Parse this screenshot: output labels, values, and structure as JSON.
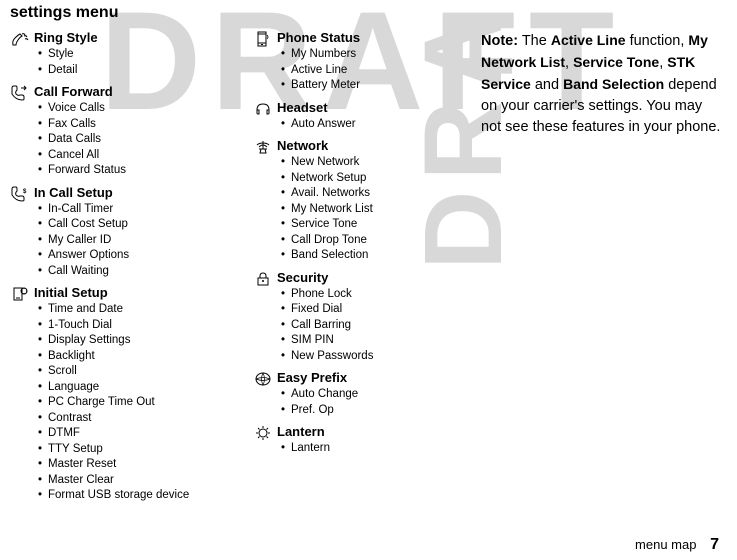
{
  "watermark": "DRAFT",
  "title": "settings menu",
  "col1": {
    "sections": [
      {
        "icon": "ring-style-icon",
        "title": "Ring Style",
        "items": [
          "Style",
          "Detail"
        ]
      },
      {
        "icon": "call-forward-icon",
        "title": "Call Forward",
        "items": [
          "Voice Calls",
          "Fax Calls",
          "Data Calls",
          "Cancel All",
          "Forward Status"
        ]
      },
      {
        "icon": "in-call-setup-icon",
        "title": "In Call Setup",
        "items": [
          "In-Call Timer",
          "Call Cost Setup",
          "My Caller ID",
          "Answer Options",
          "Call Waiting"
        ]
      },
      {
        "icon": "initial-setup-icon",
        "title": "Initial Setup",
        "items": [
          "Time and Date",
          "1-Touch Dial",
          "Display Settings",
          "Backlight",
          "Scroll",
          "Language",
          "PC Charge Time Out",
          "Contrast",
          "DTMF",
          "TTY Setup",
          "Master Reset",
          "Master Clear",
          "Format USB storage device"
        ]
      }
    ]
  },
  "col2": {
    "sections": [
      {
        "icon": "phone-status-icon",
        "title": "Phone Status",
        "items": [
          "My Numbers",
          "Active Line",
          "Battery Meter"
        ]
      },
      {
        "icon": "headset-icon",
        "title": "Headset",
        "items": [
          "Auto Answer"
        ]
      },
      {
        "icon": "network-icon",
        "title": "Network",
        "items": [
          "New Network",
          "Network Setup",
          "Avail. Networks",
          "My Network List",
          "Service Tone",
          "Call Drop Tone",
          "Band Selection"
        ]
      },
      {
        "icon": "security-icon",
        "title": "Security",
        "items": [
          "Phone Lock",
          "Fixed Dial",
          "Call Barring",
          "SIM PIN",
          "New Passwords"
        ]
      },
      {
        "icon": "easy-prefix-icon",
        "title": "Easy Prefix",
        "items": [
          "Auto Change",
          "Pref. Op"
        ]
      },
      {
        "icon": "lantern-icon",
        "title": "Lantern",
        "items": [
          "Lantern"
        ]
      }
    ]
  },
  "note": {
    "label": "Note:",
    "pre": " The ",
    "terms": [
      "Active Line",
      "My Network List",
      "Service Tone",
      "STK Service",
      "Band Selection"
    ],
    "join1": " function, ",
    "sep": ", ",
    "and": " and ",
    "post": " depend on your carrier's settings. You may not see these features in your phone."
  },
  "footer": {
    "label": "menu map",
    "page": "7"
  }
}
